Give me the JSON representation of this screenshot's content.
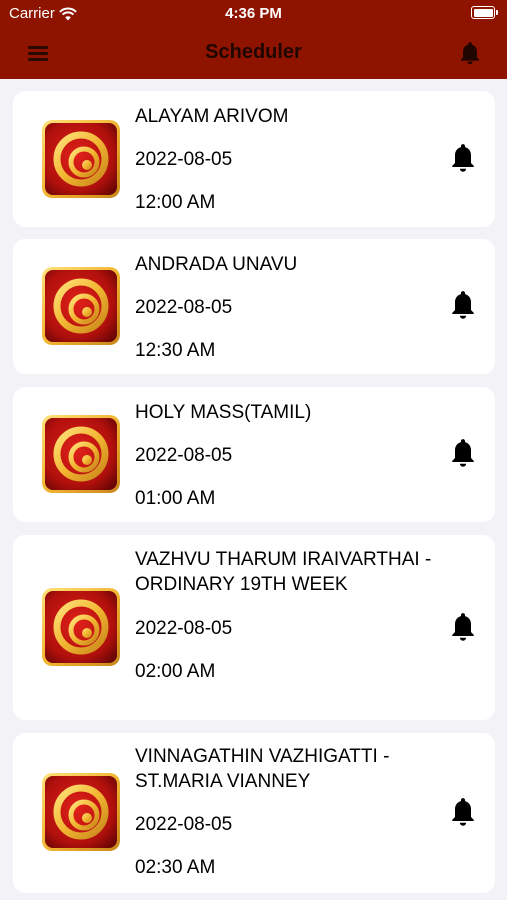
{
  "status_bar": {
    "carrier": "Carrier",
    "time": "4:36 PM"
  },
  "header": {
    "title": "Scheduler",
    "menu_icon": "hamburger-menu-icon",
    "bell_icon": "bell-icon",
    "background_color": "#8e1400"
  },
  "schedule": [
    {
      "title": "ALAYAM ARIVOM",
      "date": "2022-08-05",
      "time": "12:00 AM"
    },
    {
      "title": "ANDRADA UNAVU",
      "date": "2022-08-05",
      "time": "12:30 AM"
    },
    {
      "title": "HOLY MASS(TAMIL)",
      "date": "2022-08-05",
      "time": "01:00 AM"
    },
    {
      "title": "VAZHVU THARUM IRAIVARTHAI - ORDINARY 19TH WEEK",
      "date": "2022-08-05",
      "time": "02:00 AM"
    },
    {
      "title": "VINNAGATHIN VAZHIGATTI -ST.MARIA VIANNEY",
      "date": "2022-08-05",
      "time": "02:30 AM"
    }
  ]
}
